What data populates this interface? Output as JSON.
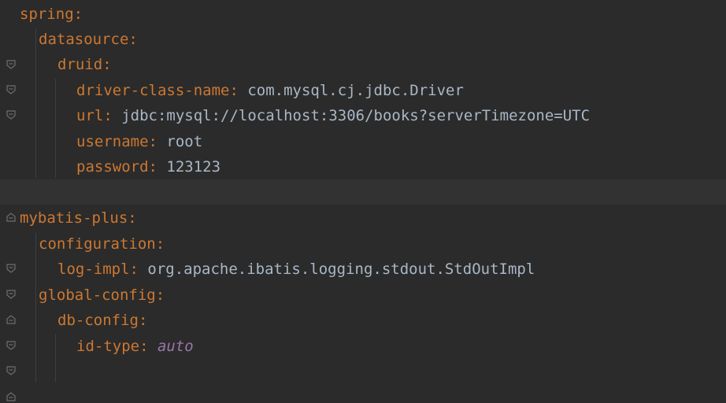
{
  "editor": {
    "lines": [
      {
        "key": "spring",
        "colon": ":",
        "value": ""
      },
      {
        "key": "datasource",
        "colon": ":",
        "value": ""
      },
      {
        "key": "druid",
        "colon": ":",
        "value": ""
      },
      {
        "key": "driver-class-name",
        "colon": ":",
        "value": " com.mysql.cj.jdbc.Driver"
      },
      {
        "key": "url",
        "colon": ":",
        "value": " jdbc:mysql://localhost:3306/books?serverTimezone=UTC"
      },
      {
        "key": "username",
        "colon": ":",
        "value": " root"
      },
      {
        "key": "password",
        "colon": ":",
        "value": " 123123"
      },
      {
        "key": "",
        "colon": "",
        "value": ""
      },
      {
        "key": "mybatis-plus",
        "colon": ":",
        "value": ""
      },
      {
        "key": "configuration",
        "colon": ":",
        "value": ""
      },
      {
        "key": "log-impl",
        "colon": ":",
        "value": " org.apache.ibatis.logging.stdout.StdOutImpl"
      },
      {
        "key": "global-config",
        "colon": ":",
        "value": ""
      },
      {
        "key": "db-config",
        "colon": ":",
        "value": ""
      },
      {
        "key": "id-type",
        "colon": ":",
        "value": " ",
        "keyword": "auto"
      },
      {
        "key": "",
        "colon": "",
        "value": ""
      }
    ]
  },
  "colors": {
    "background": "#2b2b2b",
    "yaml_key": "#cc7832",
    "plain_text": "#a9b7c6",
    "constant": "#9876aa",
    "current_line": "#323232"
  }
}
